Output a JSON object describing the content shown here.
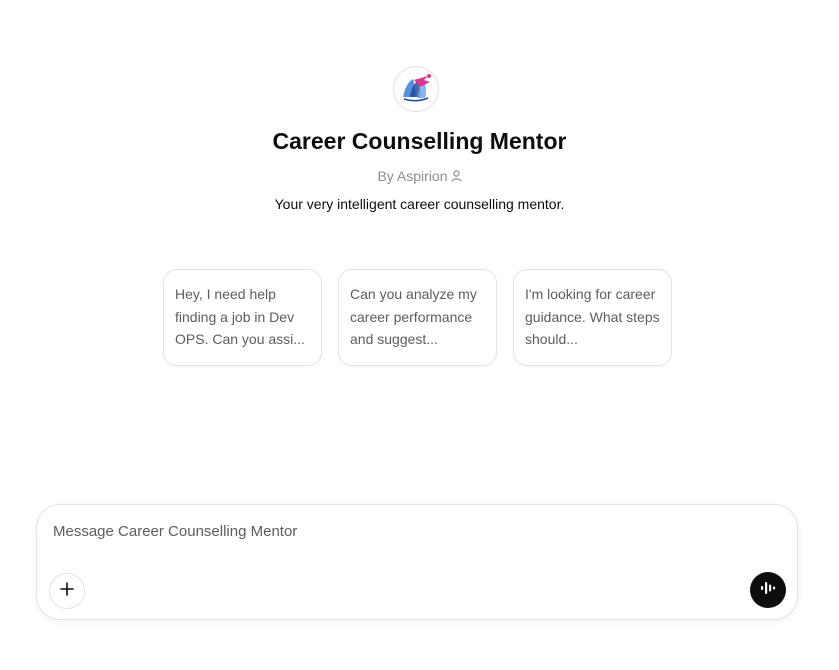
{
  "gpt": {
    "avatar_icon": "aspirion-logo-icon",
    "name": "Career Counselling Mentor",
    "byline": "By Aspirion",
    "byline_icon": "person-icon",
    "description": "Your very intelligent career counselling mentor."
  },
  "conversation_starters": [
    {
      "text": "Hey, I need help finding a job in Dev OPS. Can you assi..."
    },
    {
      "text": "Can you analyze my career performance and suggest..."
    },
    {
      "text": "I'm looking for career guidance. What steps should..."
    }
  ],
  "composer": {
    "placeholder": "Message Career Counselling Mentor",
    "value": "",
    "attach_icon": "plus-icon",
    "voice_icon": "voice-mode-icon"
  },
  "colors": {
    "text_primary": "#0d0d0d",
    "text_secondary": "#8e8e8e",
    "border": "#e3e3e3",
    "voice_button_bg": "#0d0d0d",
    "logo_blue": "#2f6fc4",
    "logo_pink": "#e0338f"
  }
}
